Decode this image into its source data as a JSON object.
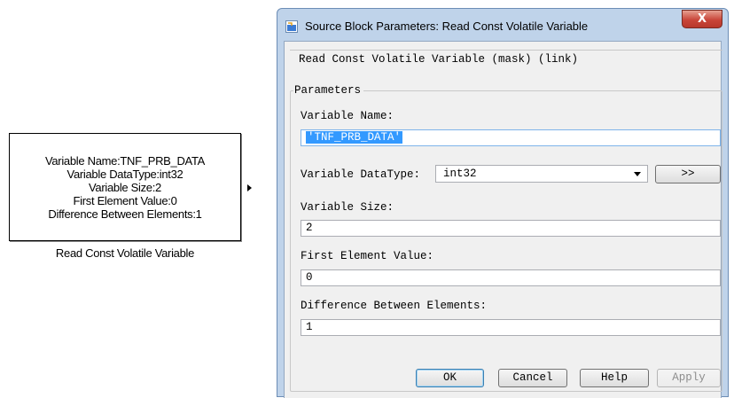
{
  "block": {
    "lines": [
      "Variable Name:TNF_PRB_DATA",
      "Variable DataType:int32",
      "Variable Size:2",
      "First Element Value:0",
      "Difference Between Elements:1"
    ],
    "caption": "Read Const Volatile Variable"
  },
  "dialog": {
    "title": "Source Block Parameters: Read Const Volatile Variable",
    "close_label": "X",
    "description": "Read Const Volatile Variable (mask) (link)",
    "parameters_label": "Parameters",
    "fields": {
      "variable_name": {
        "label": "Variable Name:",
        "value": "'TNF_PRB_DATA'"
      },
      "variable_datatype": {
        "label": "Variable DataType:",
        "value": "int32",
        "more_label": ">>"
      },
      "variable_size": {
        "label": "Variable Size:",
        "value": "2"
      },
      "first_element_value": {
        "label": "First Element Value:",
        "value": "0"
      },
      "difference": {
        "label": "Difference Between Elements:",
        "value": "1"
      }
    },
    "buttons": {
      "ok": "OK",
      "cancel": "Cancel",
      "help": "Help",
      "apply": "Apply"
    }
  },
  "colors": {
    "selection": "#3399ff",
    "frame": "#bfd3ea",
    "close": "#c9463a"
  }
}
